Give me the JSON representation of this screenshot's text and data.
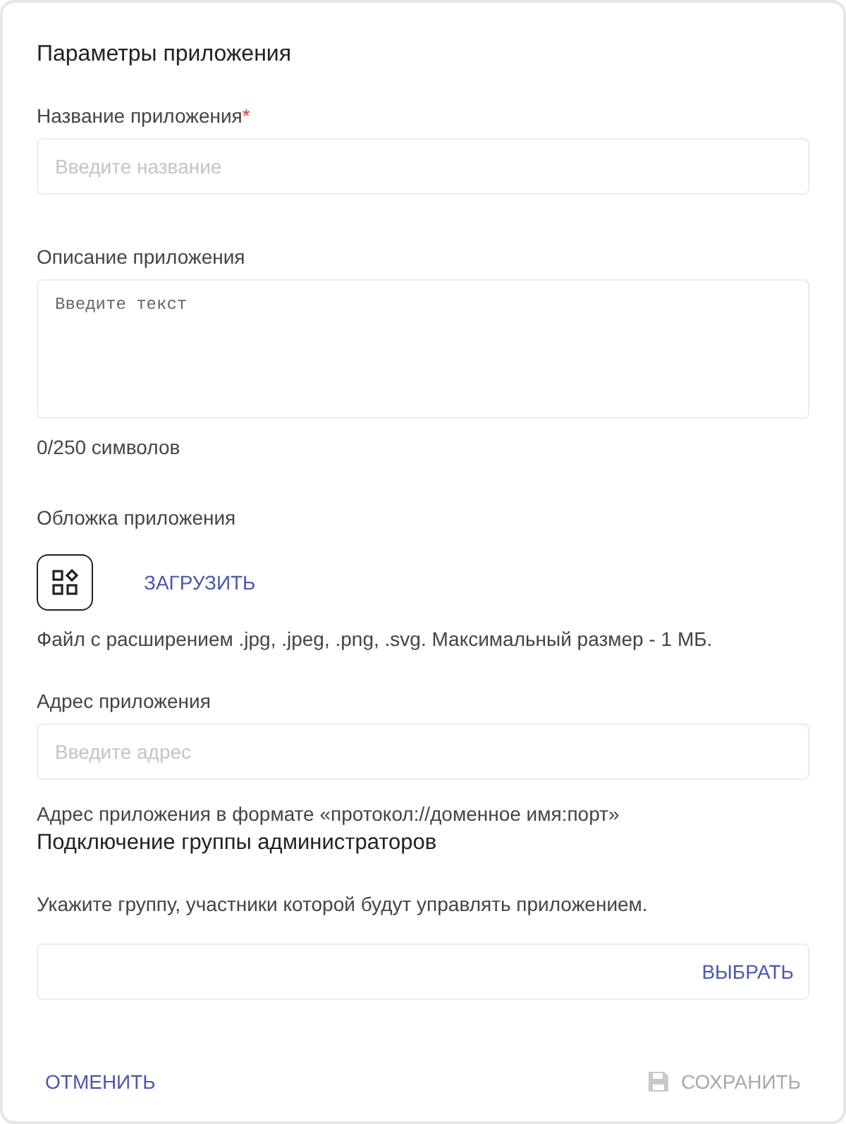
{
  "title": "Параметры приложения",
  "name_field": {
    "label": "Название приложения",
    "required_mark": "*",
    "placeholder": "Введите название"
  },
  "description_field": {
    "label": "Описание приложения",
    "placeholder": "Введите текст",
    "counter": "0/250 символов"
  },
  "cover": {
    "label": "Обложка приложения",
    "upload_button": "ЗАГРУЗИТЬ",
    "hint": "Файл с расширением .jpg, .jpeg, .png, .svg. Максимальный размер - 1 МБ."
  },
  "address_field": {
    "label": "Адрес приложения",
    "placeholder": "Введите адрес",
    "hint": "Адрес приложения в формате «протокол://доменное имя:порт»"
  },
  "admin_group": {
    "heading": "Подключение группы администраторов",
    "description": "Укажите группу, участники которой будут управлять приложением.",
    "select_button": "ВЫБРАТЬ"
  },
  "actions": {
    "cancel": {
      "label": "ОТМЕНИТЬ",
      "disabled": false
    },
    "save": {
      "label": "СОХРАНИТЬ",
      "disabled": true
    }
  }
}
